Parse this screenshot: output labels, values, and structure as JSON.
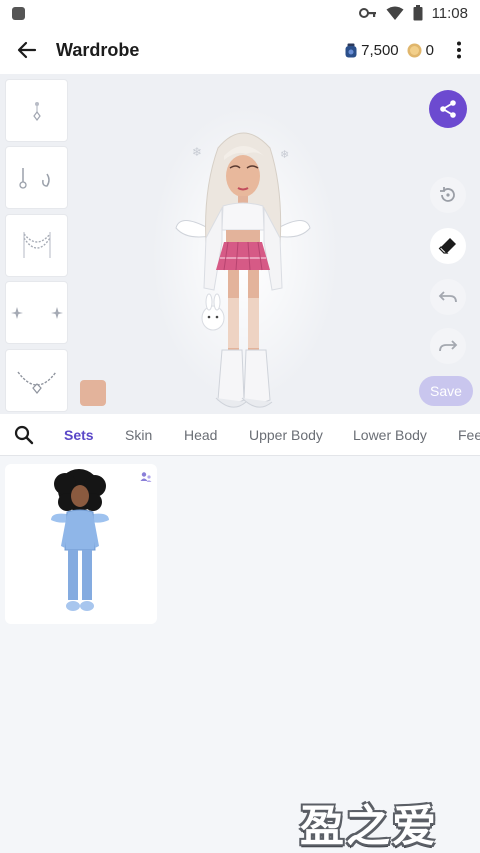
{
  "status_bar": {
    "time": "11:08"
  },
  "header": {
    "title": "Wardrobe"
  },
  "currency": {
    "gems": "7,500",
    "coins": "0"
  },
  "actions": {
    "save_label": "Save"
  },
  "colors": {
    "accent": "#5a47c8",
    "share": "#6c4ad0",
    "save_disabled": "#c9c6ee",
    "skin_tone": "#e3b39b"
  },
  "accessory_slots": [
    "earring-icon",
    "hair-clip-icon",
    "necklace-layers-icon",
    "sparkle-icon",
    "chain-necklace-icon"
  ],
  "tabs": [
    {
      "label": "Sets",
      "active": true
    },
    {
      "label": "Skin",
      "active": false
    },
    {
      "label": "Head",
      "active": false
    },
    {
      "label": "Upper Body",
      "active": false
    },
    {
      "label": "Lower Body",
      "active": false
    },
    {
      "label": "Feet",
      "active": false
    }
  ],
  "watermark": "盈之爱"
}
